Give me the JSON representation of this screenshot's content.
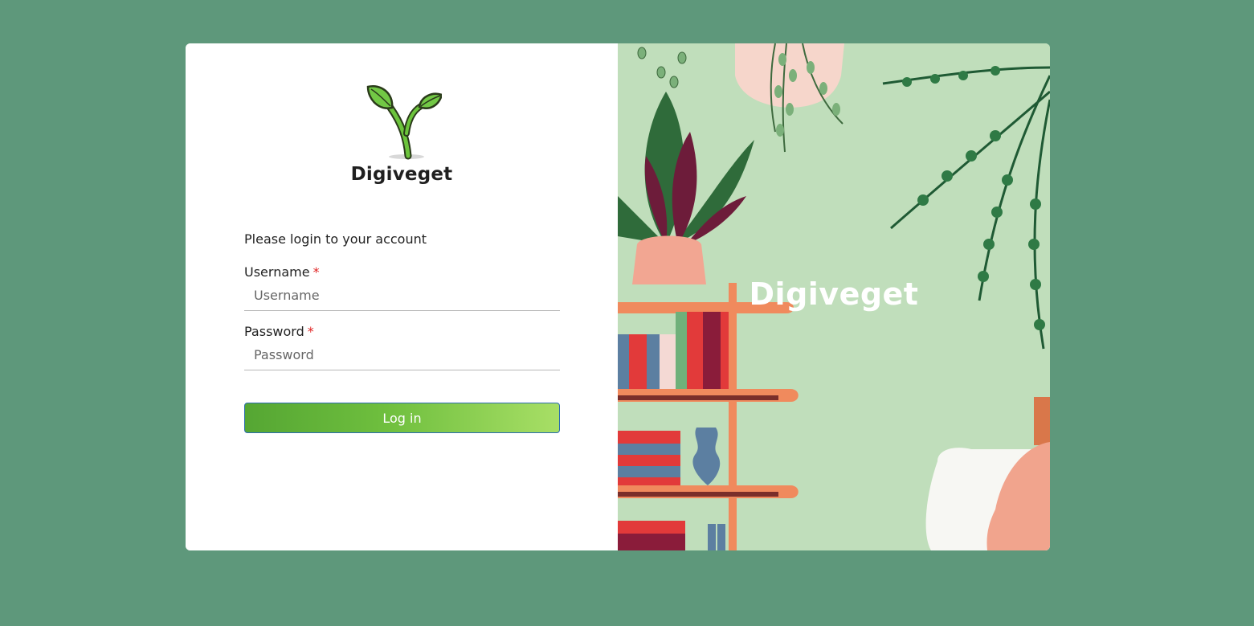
{
  "brand": {
    "name": "Digiveget",
    "logo_icon": "sprout-icon",
    "accent_color": "#6fbf3e",
    "background_color": "#5e987b"
  },
  "form": {
    "subtitle": "Please login to your account",
    "username": {
      "label": "Username",
      "required_mark": "*",
      "placeholder": "Username",
      "value": ""
    },
    "password": {
      "label": "Password",
      "required_mark": "*",
      "placeholder": "Password",
      "value": ""
    },
    "submit_label": "Log in"
  },
  "hero": {
    "title": "Digiveget",
    "illustration": "houseplants-bookshelf-illustration"
  }
}
